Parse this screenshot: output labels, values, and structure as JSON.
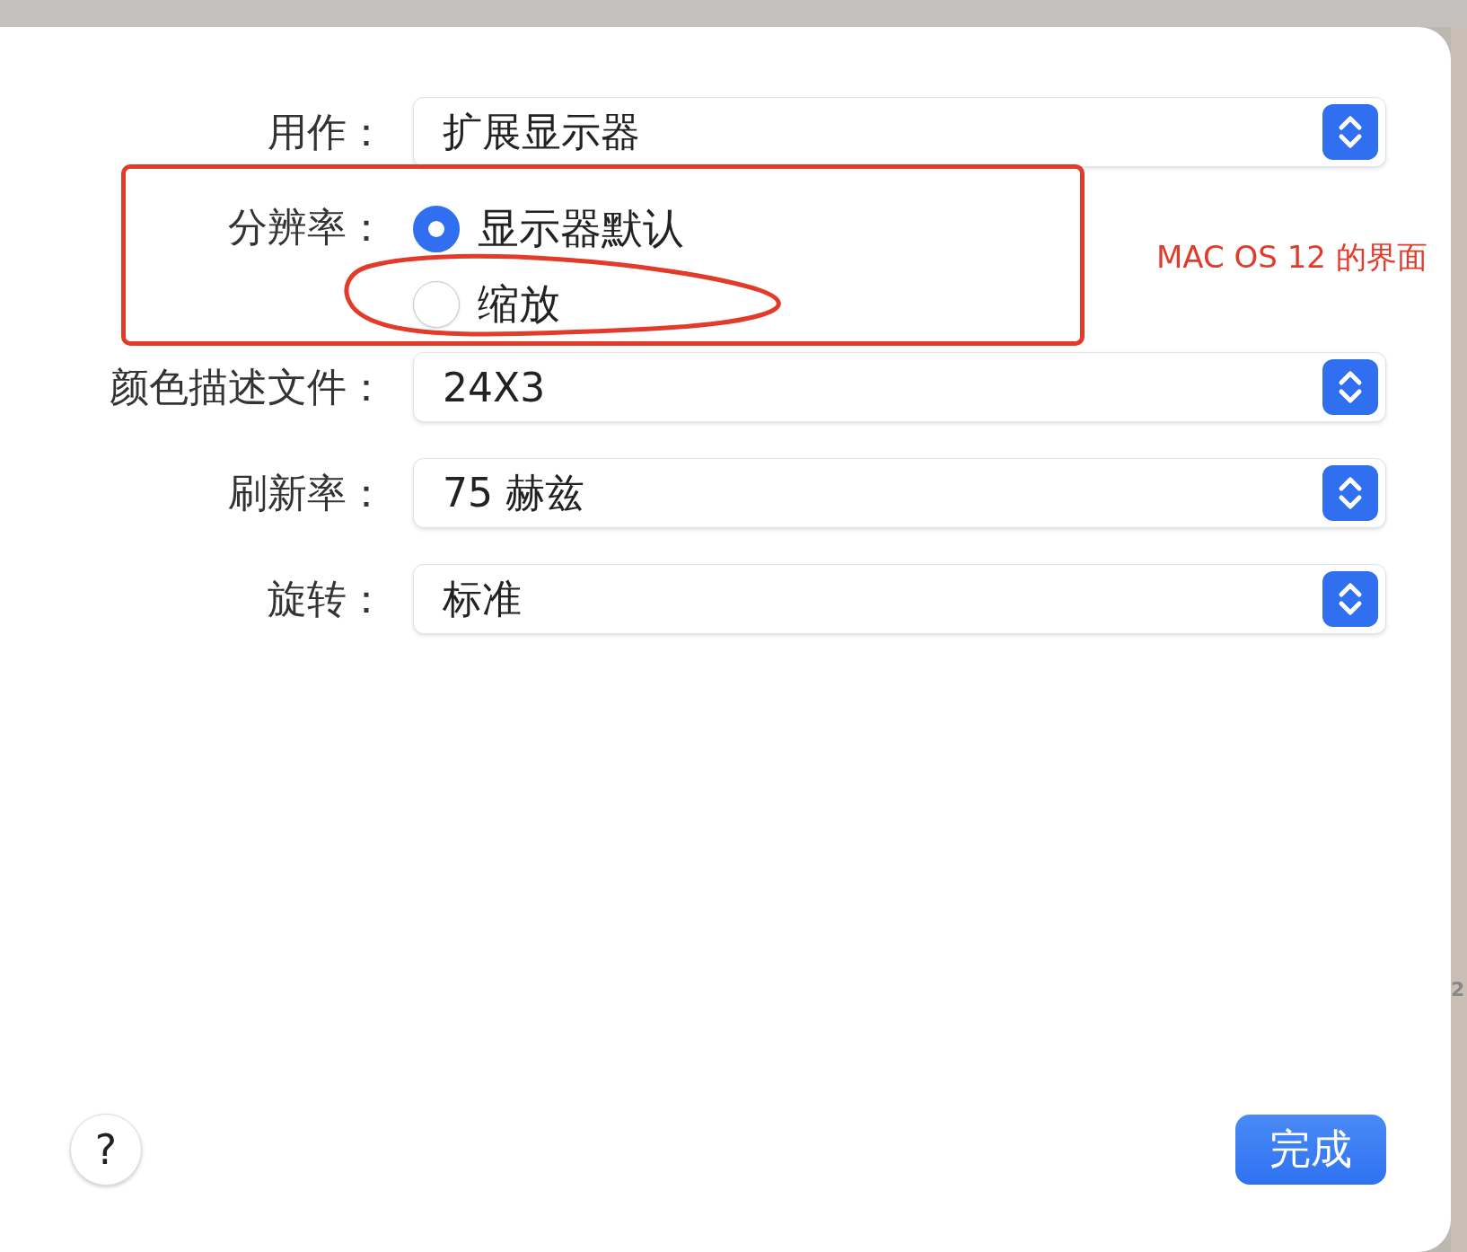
{
  "form": {
    "use_as": {
      "label": "用作：",
      "value": "扩展显示器"
    },
    "resolution": {
      "label": "分辨率：",
      "options": [
        {
          "label": "显示器默认",
          "selected": true
        },
        {
          "label": "缩放",
          "selected": false
        }
      ]
    },
    "selects": [
      {
        "label": "颜色描述文件：",
        "value": "24X3"
      },
      {
        "label": "刷新率：",
        "value": "75 赫兹"
      },
      {
        "label": "旋转：",
        "value": "标准"
      }
    ]
  },
  "footer": {
    "help": "?",
    "done": "完成"
  },
  "annotation": {
    "note": "MAC OS 12 的界面"
  },
  "background_fragment": "2"
}
